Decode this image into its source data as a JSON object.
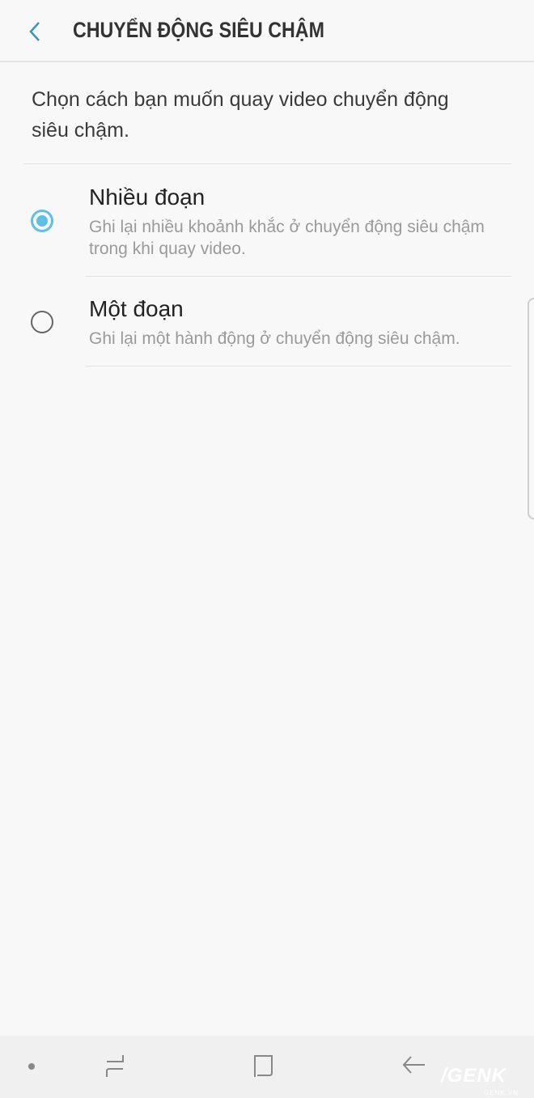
{
  "header": {
    "title": "CHUYỂN ĐỘNG SIÊU CHẬM",
    "back_icon": "chevron-left-icon"
  },
  "description": "Chọn cách bạn muốn quay video chuyển động siêu chậm.",
  "options": [
    {
      "title": "Nhiều đoạn",
      "subtitle": "Ghi lại nhiều khoảnh khắc ở chuyển động siêu chậm trong khi quay video.",
      "selected": true
    },
    {
      "title": "Một đoạn",
      "subtitle": "Ghi lại một hành động ở chuyển động siêu chậm.",
      "selected": false
    }
  ],
  "colors": {
    "accent": "#5ec0e6",
    "background": "#f8f8f8",
    "navbar": "#f0f0f0"
  },
  "watermark": {
    "logo": "/GENK",
    "url": "GENK.VN"
  }
}
